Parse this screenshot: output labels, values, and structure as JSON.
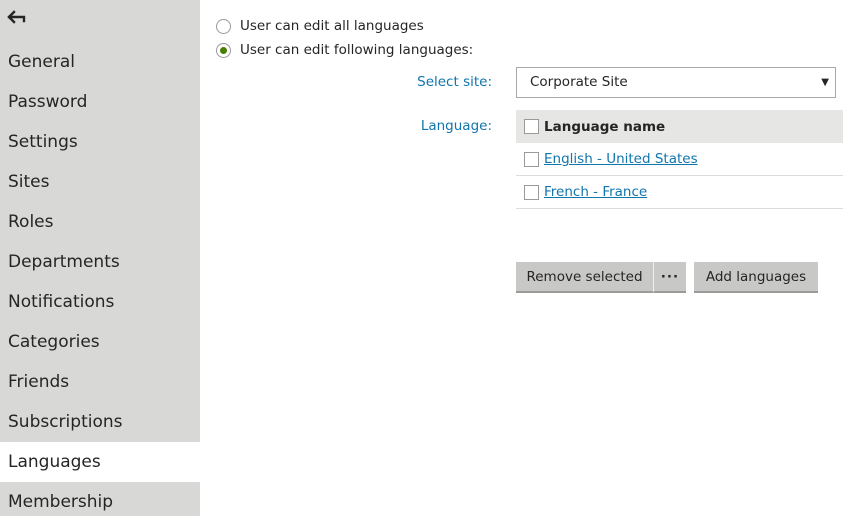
{
  "sidebar": {
    "back_icon": "back-arrow-icon",
    "items": [
      {
        "label": "General"
      },
      {
        "label": "Password"
      },
      {
        "label": "Settings"
      },
      {
        "label": "Sites"
      },
      {
        "label": "Roles"
      },
      {
        "label": "Departments"
      },
      {
        "label": "Notifications"
      },
      {
        "label": "Categories"
      },
      {
        "label": "Friends"
      },
      {
        "label": "Subscriptions"
      },
      {
        "label": "Languages"
      },
      {
        "label": "Membership"
      }
    ],
    "active": "Languages"
  },
  "options": {
    "all_languages": "User can edit all languages",
    "following_languages": "User can edit following languages:",
    "selected": "following_languages"
  },
  "site": {
    "label": "Select site:",
    "value": "Corporate Site",
    "caret": "▼"
  },
  "languages": {
    "label": "Language:",
    "column_header": "Language name",
    "rows": [
      {
        "name": "English - United States"
      },
      {
        "name": "French - France"
      }
    ]
  },
  "actions": {
    "remove_label": "Remove selected",
    "more_label": "···",
    "add_label": "Add languages"
  },
  "colors": {
    "sidebar_bg": "#d8d9d6",
    "link": "#1175ae",
    "radio_checked": "#497d04",
    "button_bg": "#c8c8c6"
  }
}
